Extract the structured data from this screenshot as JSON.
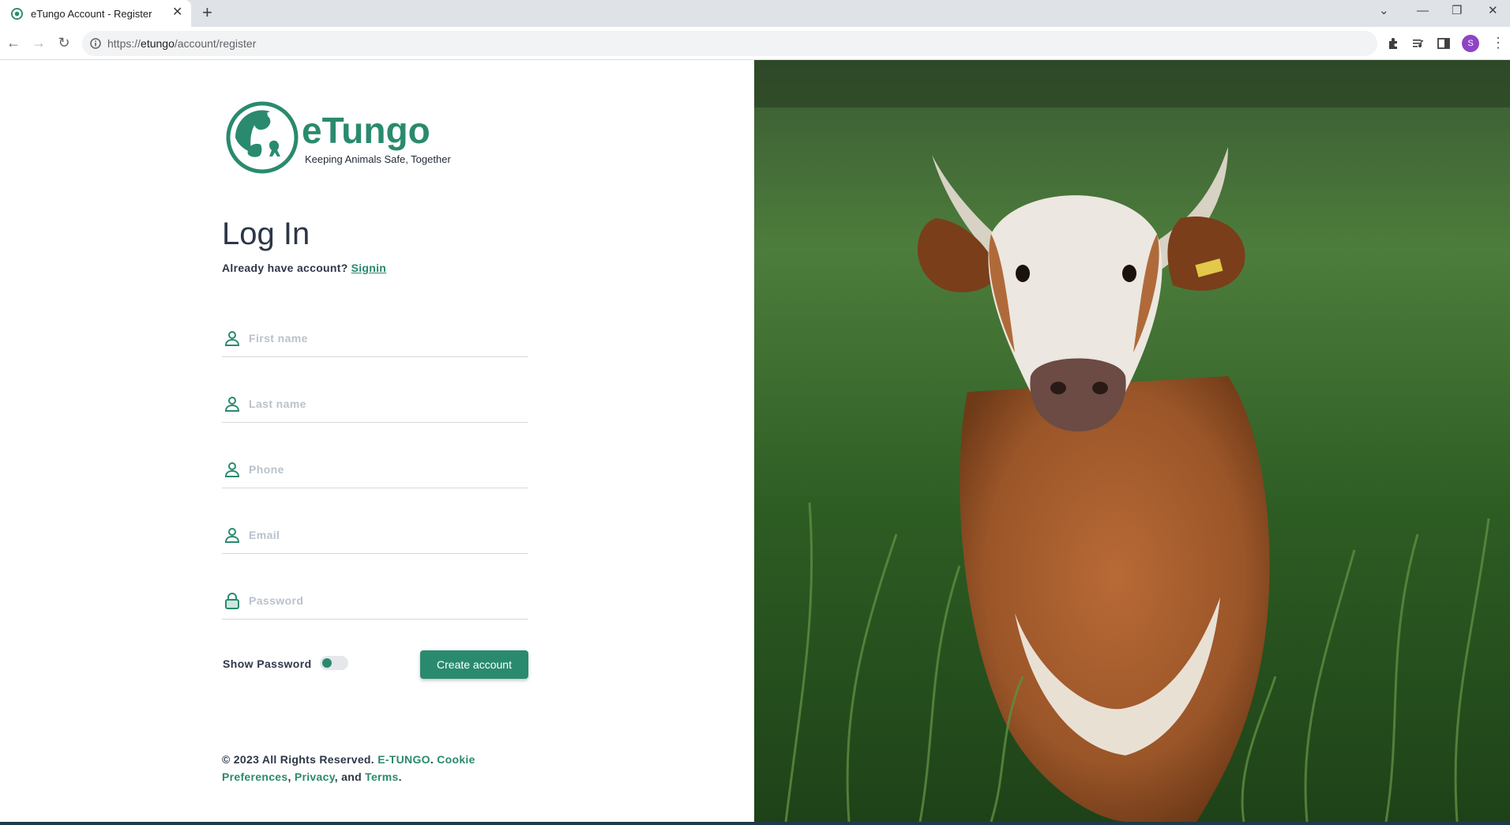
{
  "browser": {
    "tab_title": "eTungo Account - Register",
    "url_prefix": "https://",
    "url_host": "etungo",
    "url_path": "/account/register",
    "profile_initial": "S"
  },
  "brand": {
    "name": "eTungo",
    "tagline": "Keeping Animals Safe, Together",
    "color": "#2a8a6e"
  },
  "form": {
    "heading": "Log In",
    "subline_text": "Already have account?",
    "signin_link": "Signin",
    "fields": [
      {
        "icon": "user-icon",
        "placeholder": "First name",
        "value": ""
      },
      {
        "icon": "user-icon",
        "placeholder": "Last name",
        "value": ""
      },
      {
        "icon": "user-icon",
        "placeholder": "Phone",
        "value": ""
      },
      {
        "icon": "user-icon",
        "placeholder": "Email",
        "value": ""
      },
      {
        "icon": "lock-icon",
        "placeholder": "Password",
        "value": ""
      }
    ],
    "show_password_label": "Show Password",
    "show_password_on": false,
    "submit_label": "Create account"
  },
  "footer": {
    "copyright": "© 2023 All Rights Reserved.",
    "company": "E-TUNGO",
    "cookie": "Cookie Preferences",
    "privacy": "Privacy",
    "and": "and",
    "terms": "Terms"
  }
}
